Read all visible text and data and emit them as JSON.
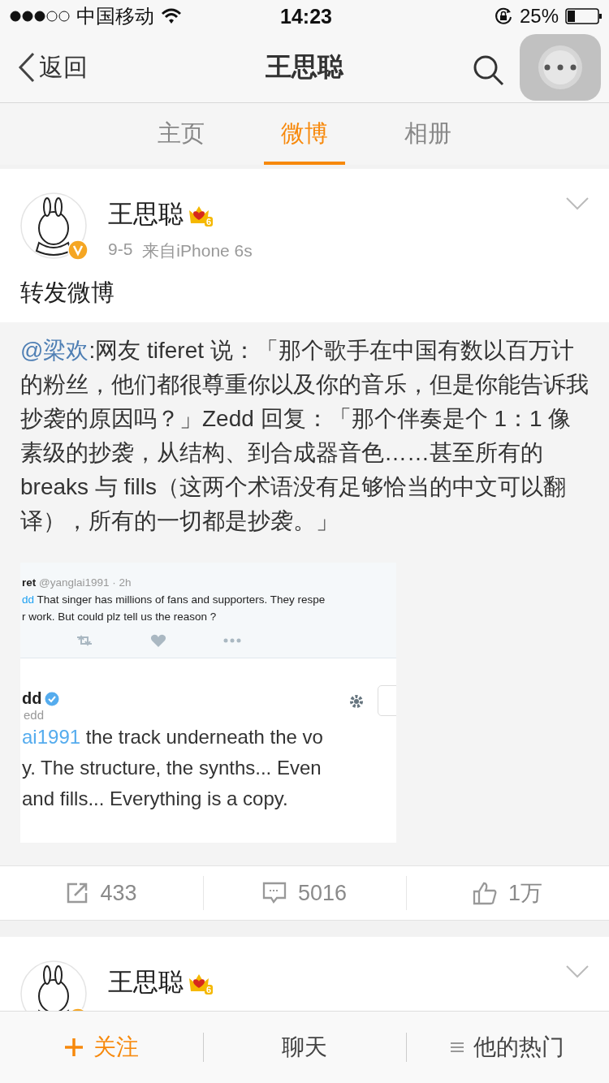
{
  "status_bar": {
    "carrier": "中国移动",
    "time": "14:23",
    "battery": "25%"
  },
  "nav": {
    "back": "返回",
    "title": "王思聪"
  },
  "tabs": [
    {
      "label": "主页",
      "selected": false
    },
    {
      "label": "微博",
      "selected": true
    },
    {
      "label": "相册",
      "selected": false
    }
  ],
  "posts": [
    {
      "author": "王思聪",
      "vip_level": "6",
      "date": "9-5",
      "source": "来自iPhone 6s",
      "text": "转发微博",
      "retweet": {
        "mention": "@梁欢",
        "text": ":网友 tiferet 说：「那个歌手在中国有数以百万计的粉丝，他们都很尊重你以及你的音乐，但是你能告诉我抄袭的原因吗？」Zedd 回复：「那个伴奏是个 1：1 像素级的抄袭，从结构、到合成器音色……甚至所有的 breaks 与 fills（这两个术语没有足够恰当的中文可以翻译），所有的一切都是抄袭。」",
        "image": {
          "reply": {
            "author": "ret",
            "handle": "@yanglai1991 · 2h",
            "mention": "dd",
            "lines": [
              "That singer has millions of fans and supporters. They respe",
              "r work. But could plz tell us the reason ?"
            ]
          },
          "profile": {
            "name": "dd",
            "handle": "edd"
          },
          "tweet": {
            "mention": "ai1991",
            "lines": [
              "the track underneath the vo",
              "y. The structure, the synths... Even",
              "and fills... Everything is a copy."
            ]
          }
        }
      },
      "actions": [
        {
          "kind": "repost",
          "count": "433"
        },
        {
          "kind": "comment",
          "count": "5016"
        },
        {
          "kind": "like",
          "count": "1万"
        }
      ]
    },
    {
      "author": "王思聪",
      "vip_level": "6"
    }
  ],
  "bottom_bar": [
    {
      "kind": "follow",
      "label": "关注"
    },
    {
      "kind": "chat",
      "label": "聊天"
    },
    {
      "kind": "menu",
      "label": "他的热门"
    }
  ]
}
